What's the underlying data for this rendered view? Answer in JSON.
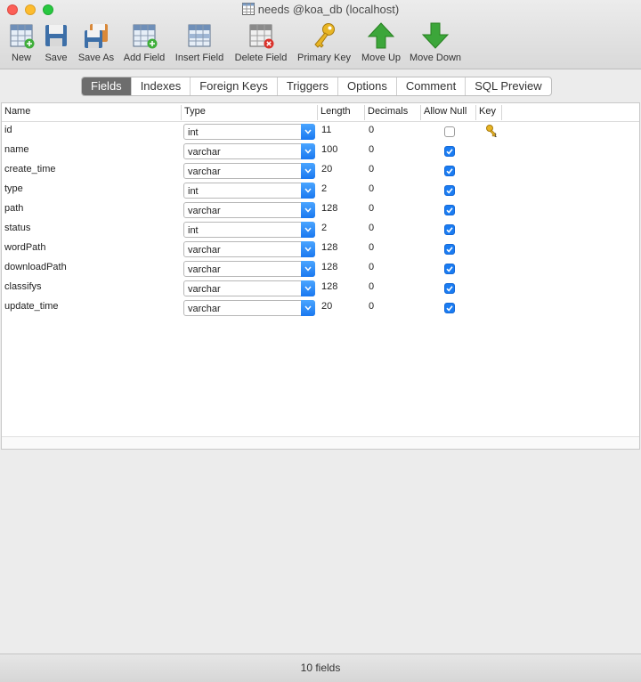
{
  "window": {
    "title": "needs @koa_db (localhost)"
  },
  "toolbar": {
    "new": "New",
    "save": "Save",
    "save_as": "Save As",
    "add_field": "Add Field",
    "insert_field": "Insert Field",
    "delete_field": "Delete Field",
    "primary_key": "Primary Key",
    "move_up": "Move Up",
    "move_down": "Move Down"
  },
  "tabs": [
    "Fields",
    "Indexes",
    "Foreign Keys",
    "Triggers",
    "Options",
    "Comment",
    "SQL Preview"
  ],
  "active_tab": "Fields",
  "columns": [
    "Name",
    "Type",
    "Length",
    "Decimals",
    "Allow Null",
    "Key"
  ],
  "fields": [
    {
      "name": "id",
      "type": "int",
      "length": "11",
      "decimals": "0",
      "allow_null": false,
      "key": true
    },
    {
      "name": "name",
      "type": "varchar",
      "length": "100",
      "decimals": "0",
      "allow_null": true,
      "key": false
    },
    {
      "name": "create_time",
      "type": "varchar",
      "length": "20",
      "decimals": "0",
      "allow_null": true,
      "key": false
    },
    {
      "name": "type",
      "type": "int",
      "length": "2",
      "decimals": "0",
      "allow_null": true,
      "key": false
    },
    {
      "name": "path",
      "type": "varchar",
      "length": "128",
      "decimals": "0",
      "allow_null": true,
      "key": false
    },
    {
      "name": "status",
      "type": "int",
      "length": "2",
      "decimals": "0",
      "allow_null": true,
      "key": false
    },
    {
      "name": "wordPath",
      "type": "varchar",
      "length": "128",
      "decimals": "0",
      "allow_null": true,
      "key": false
    },
    {
      "name": "downloadPath",
      "type": "varchar",
      "length": "128",
      "decimals": "0",
      "allow_null": true,
      "key": false
    },
    {
      "name": "classifys",
      "type": "varchar",
      "length": "128",
      "decimals": "0",
      "allow_null": true,
      "key": false
    },
    {
      "name": "update_time",
      "type": "varchar",
      "length": "20",
      "decimals": "0",
      "allow_null": true,
      "key": false
    }
  ],
  "status": {
    "text": "10 fields"
  },
  "colors": {
    "accent": "#1a7cf2",
    "active_tab": "#6d6d6d"
  }
}
